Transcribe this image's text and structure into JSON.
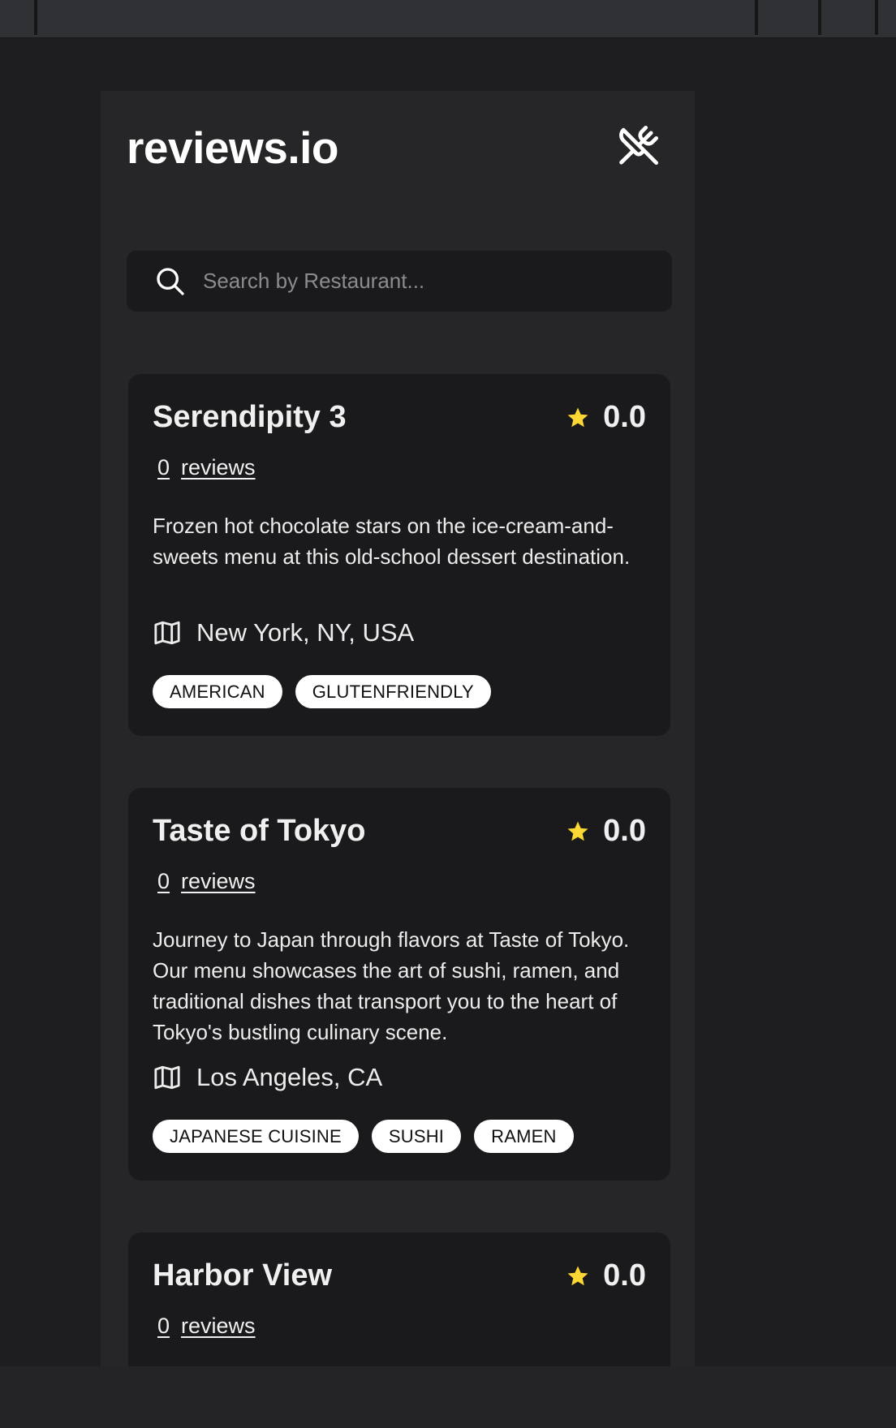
{
  "app": {
    "title": "reviews.io",
    "header_icon": "utensils-crossed-icon"
  },
  "search": {
    "placeholder": "Search by Restaurant...",
    "icon": "search-icon"
  },
  "restaurants": [
    {
      "name": "Serendipity 3",
      "rating": "0.0",
      "review_count": "0",
      "reviews_label": "reviews",
      "description": "Frozen hot chocolate stars on the ice-cream-and-sweets menu at this old-school dessert destination.",
      "location": "New York, NY, USA",
      "tags": [
        "AMERICAN",
        "GLUTENFRIENDLY"
      ]
    },
    {
      "name": "Taste of Tokyo",
      "rating": "0.0",
      "review_count": "0",
      "reviews_label": "reviews",
      "description": "Journey to Japan through flavors at Taste of Tokyo. Our menu showcases the art of sushi, ramen, and traditional dishes that transport you to the heart of Tokyo's bustling culinary scene.",
      "location": "Los Angeles, CA",
      "tags": [
        "JAPANESE CUISINE",
        "SUSHI",
        "RAMEN"
      ]
    },
    {
      "name": "Harbor View",
      "rating": "0.0",
      "review_count": "0",
      "reviews_label": "reviews"
    }
  ],
  "colors": {
    "background": "#1e1e20",
    "panel": "#262628",
    "card": "#1a1a1c",
    "star": "#fdd835",
    "tag_bg": "#ffffff"
  }
}
